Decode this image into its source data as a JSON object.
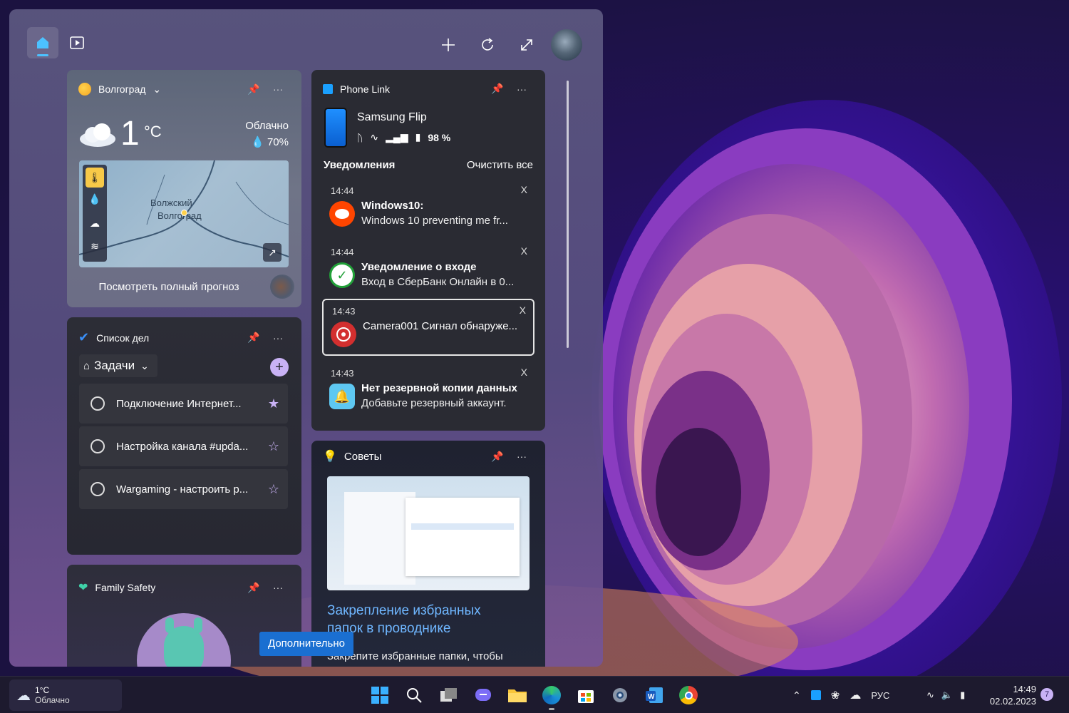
{
  "weather_widget": {
    "location": "Волгоград",
    "temp": "1",
    "unit": "°C",
    "condition": "Облачно",
    "humidity": "70%",
    "map_label_1": "Волжский",
    "map_label_2": "Волгоград",
    "forecast_link": "Посмотреть полный прогноз"
  },
  "todo_widget": {
    "title": "Список дел",
    "list_name": "Задачи",
    "tasks": [
      {
        "label": "Подключение Интернет...",
        "starred": true
      },
      {
        "label": "Настройка канала #upda...",
        "starred": false
      },
      {
        "label": "Wargaming - настроить р...",
        "starred": false
      }
    ]
  },
  "family_widget": {
    "title": "Family Safety"
  },
  "phone_widget": {
    "title": "Phone Link",
    "device": "Samsung Flip",
    "battery": "98 %",
    "notifications_label": "Уведомления",
    "clear_all": "Очистить все",
    "notifications": [
      {
        "time": "14:44",
        "title": "Windows10:",
        "body": "Windows 10 preventing me fr...",
        "close": "X",
        "icon": "reddit-icon"
      },
      {
        "time": "14:44",
        "title": "Уведомление о входе",
        "body": "Вход в СберБанк Онлайн в 0...",
        "close": "X",
        "icon": "sberbank-icon"
      },
      {
        "time": "14:43",
        "title": "Camera001 Сигнал обнаруже...",
        "body": "",
        "close": "X",
        "icon": "camera-icon"
      },
      {
        "time": "14:43",
        "title": "Нет резервной копии данных",
        "body": "Добавьте резервный аккаунт.",
        "close": "X",
        "icon": "bell-icon"
      }
    ]
  },
  "tips_widget": {
    "title": "Советы",
    "headline_1": "Закрепление избранных",
    "headline_2": "папок в проводнике",
    "body": "Закрепите избранные папки, чтобы",
    "more_button": "Дополнительно"
  },
  "taskbar": {
    "weather_temp": "1°C",
    "weather_cond": "Облачно",
    "lang": "РУС",
    "time": "14:49",
    "date": "02.02.2023",
    "badge": "7"
  },
  "colors": {
    "accent": "#4cc2ff",
    "button_blue": "#1a6fd1",
    "card_dark": "#2a2b33"
  }
}
